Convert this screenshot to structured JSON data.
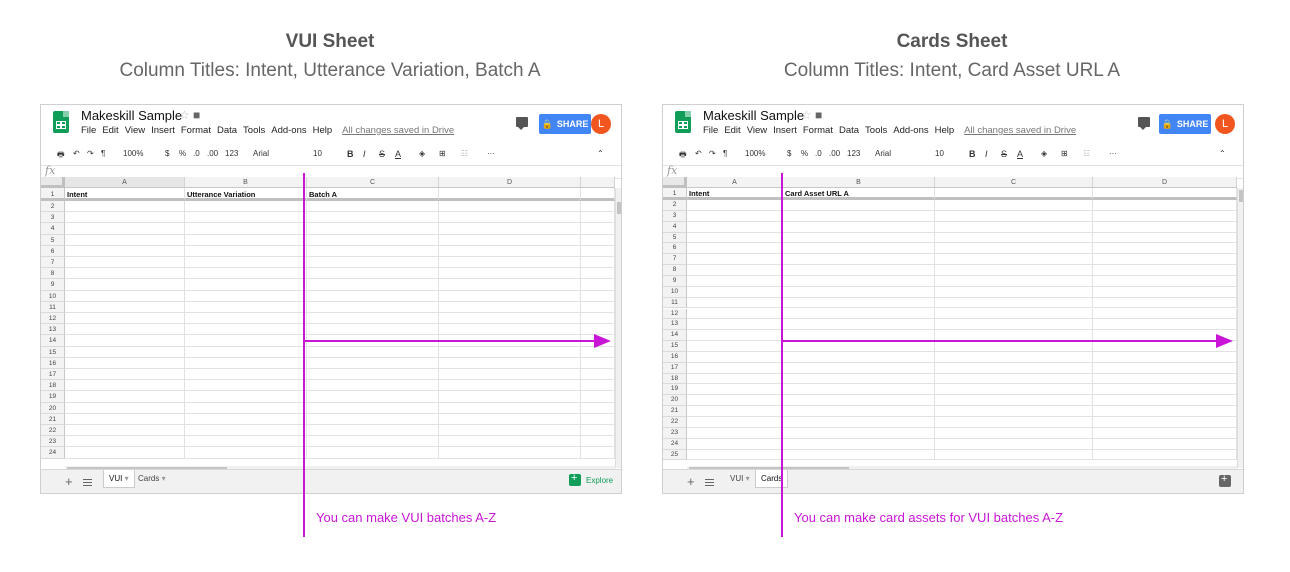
{
  "left_panel": {
    "heading": "VUI Sheet",
    "subheading": "Column Titles: Intent, Utterance Variation, Batch A",
    "caption": "You can make VUI batches A-Z",
    "spreadsheet": {
      "title": "Makeskill Sample",
      "menus": [
        "File",
        "Edit",
        "View",
        "Insert",
        "Format",
        "Data",
        "Tools",
        "Add-ons",
        "Help"
      ],
      "save_status": "All changes saved in Drive",
      "share_label": "SHARE",
      "avatar_initial": "L",
      "toolbar": {
        "zoom": "100%",
        "currency": "$",
        "percent": "%",
        "dec_dec": ".0",
        "dec_inc": ".00",
        "format": "123",
        "font": "Arial",
        "font_size": "10",
        "bold": "B",
        "italic": "I",
        "strike": "S",
        "text_color": "A",
        "more": "···"
      },
      "fx": "fx",
      "columns": [
        "A",
        "B",
        "C",
        "D"
      ],
      "header_row": [
        "Intent",
        "Utterance Variation",
        "Batch A",
        ""
      ],
      "row_numbers": [
        "1",
        "2",
        "3",
        "4",
        "5",
        "6",
        "7",
        "8",
        "9",
        "10",
        "11",
        "12",
        "13",
        "14",
        "15",
        "16",
        "17",
        "18",
        "19",
        "20",
        "21",
        "22",
        "23",
        "24"
      ],
      "tabs": [
        "VUI",
        "Cards"
      ],
      "active_tab": "VUI",
      "explore_label": "Explore"
    }
  },
  "right_panel": {
    "heading": "Cards Sheet",
    "subheading": "Column Titles: Intent, Card Asset URL A",
    "caption": "You can make card assets for VUI batches A-Z",
    "spreadsheet": {
      "title": "Makeskill Sample",
      "menus": [
        "File",
        "Edit",
        "View",
        "Insert",
        "Format",
        "Data",
        "Tools",
        "Add-ons",
        "Help"
      ],
      "save_status": "All changes saved in Drive",
      "share_label": "SHARE",
      "avatar_initial": "L",
      "toolbar": {
        "zoom": "100%",
        "currency": "$",
        "percent": "%",
        "dec_dec": ".0",
        "dec_inc": ".00",
        "format": "123",
        "font": "Arial",
        "font_size": "10",
        "bold": "B",
        "italic": "I",
        "strike": "S",
        "text_color": "A",
        "more": "···"
      },
      "fx": "fx",
      "columns": [
        "A",
        "B",
        "C",
        "D"
      ],
      "header_row": [
        "Intent",
        "Card Asset URL A",
        "",
        ""
      ],
      "row_numbers": [
        "1",
        "2",
        "3",
        "4",
        "5",
        "6",
        "7",
        "8",
        "9",
        "10",
        "11",
        "12",
        "13",
        "14",
        "15",
        "16",
        "17",
        "18",
        "19",
        "20",
        "21",
        "22",
        "23",
        "24",
        "25"
      ],
      "tabs": [
        "VUI",
        "Cards"
      ],
      "active_tab": "Cards"
    }
  },
  "accent_color": "#c815d6"
}
